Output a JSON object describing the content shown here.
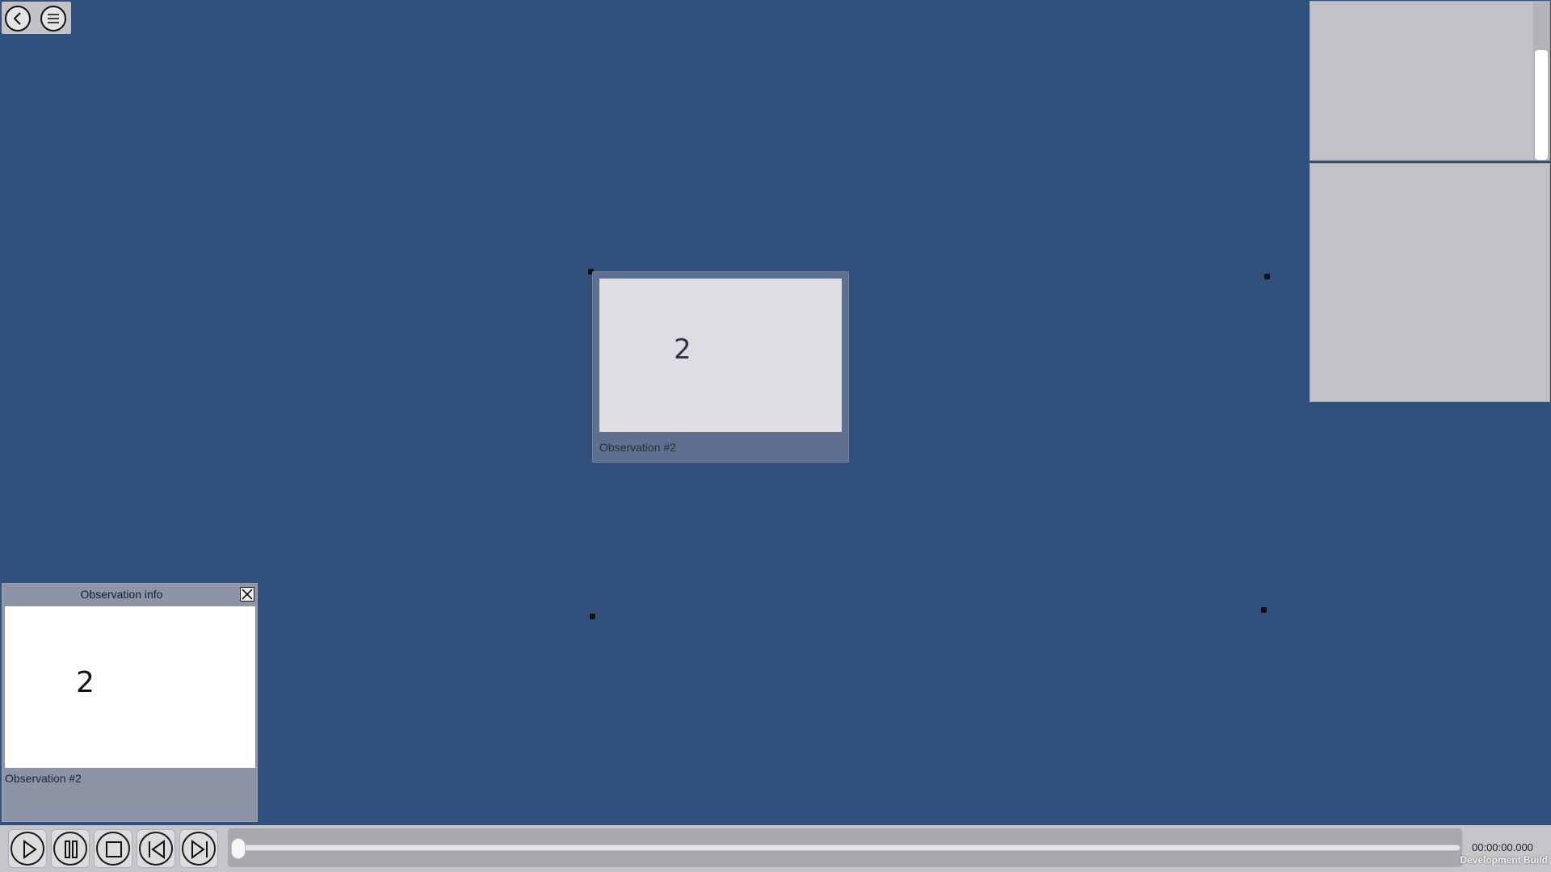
{
  "nav": {
    "back_icon": "chevron-left-icon",
    "menu_icon": "menu-icon"
  },
  "observation_card": {
    "number": "2",
    "label": "Observation #2"
  },
  "info_panel": {
    "title": "Observation info",
    "number": "2",
    "label": "Observation #2",
    "close_icon": "close-icon"
  },
  "playback": {
    "controls": [
      "play-icon",
      "pause-icon",
      "stop-icon",
      "skip-back-icon",
      "skip-forward-icon"
    ],
    "progress": 0,
    "time": "00:00:00.000"
  },
  "footer": {
    "build_label": "Development Build"
  },
  "colors": {
    "background": "#32507c",
    "panel": "#c1c2c5",
    "card": "#5e6f8f"
  }
}
